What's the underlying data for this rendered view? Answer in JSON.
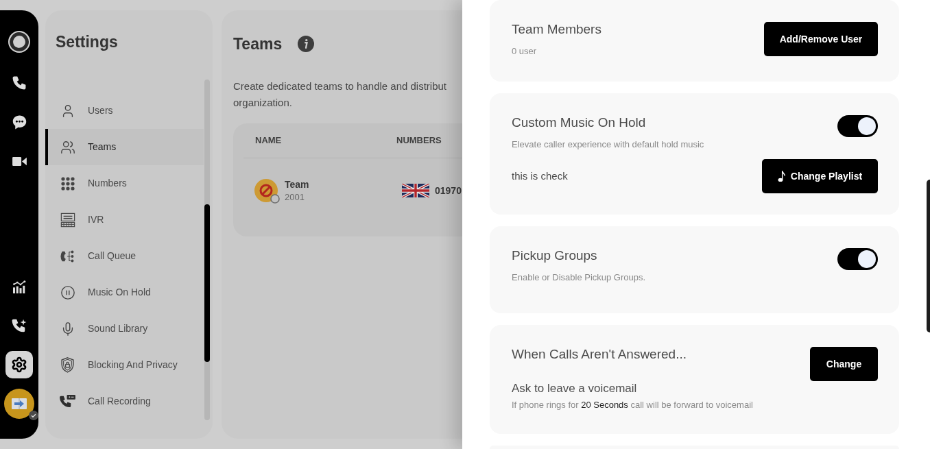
{
  "nav_rail": {
    "top_items": [
      {
        "kind": "phone",
        "selected": false
      },
      {
        "kind": "chat",
        "selected": false
      },
      {
        "kind": "video",
        "selected": false
      }
    ],
    "bottom_items": [
      {
        "kind": "analytics",
        "selected": false
      },
      {
        "kind": "call_activity",
        "selected": false
      },
      {
        "kind": "settings",
        "selected": true
      }
    ]
  },
  "settings": {
    "title": "Settings",
    "items": [
      {
        "kind": "user",
        "label": "Users",
        "selected": false
      },
      {
        "kind": "team",
        "label": "Teams",
        "selected": true
      },
      {
        "kind": "keypad",
        "label": "Numbers",
        "selected": false
      },
      {
        "kind": "ivr",
        "label": "IVR",
        "selected": false
      },
      {
        "kind": "queue",
        "label": "Call Queue",
        "selected": false
      },
      {
        "kind": "pause",
        "label": "Music On Hold",
        "selected": false
      },
      {
        "kind": "mic",
        "label": "Sound Library",
        "selected": false
      },
      {
        "kind": "shield",
        "label": "Blocking And Privacy",
        "selected": false
      },
      {
        "kind": "recording",
        "label": "Call Recording",
        "selected": false
      }
    ]
  },
  "teams": {
    "title": "Teams",
    "description_lines": [
      "Create dedicated teams to handle and distribut",
      "organization."
    ],
    "table": {
      "columns": [
        "NAME",
        "NUMBERS"
      ],
      "rows": [
        {
          "name": "Team",
          "extension": "2001",
          "number": "01970"
        }
      ]
    }
  },
  "drawer": {
    "cards": [
      {
        "kind": "button",
        "title": "Team Members",
        "subtitle": "0 user",
        "button": "Add/Remove User"
      },
      {
        "kind": "toggle",
        "title": "Custom Music On Hold",
        "subtitle": "Elevate caller experience with default hold music",
        "on": true,
        "note": "this is check",
        "button": "Change Playlist"
      },
      {
        "kind": "toggle",
        "title": "Pickup Groups",
        "subtitle": "Enable or Disable Pickup Groups.",
        "on": true
      },
      {
        "kind": "rule",
        "title": "When Calls Aren't Answered...",
        "button": "Change",
        "action": "Ask to leave a voicemail",
        "detail": {
          "before": "If phone rings for",
          "highlight": "20 Seconds",
          "after": "call will be forward to voicemail"
        }
      }
    ]
  }
}
